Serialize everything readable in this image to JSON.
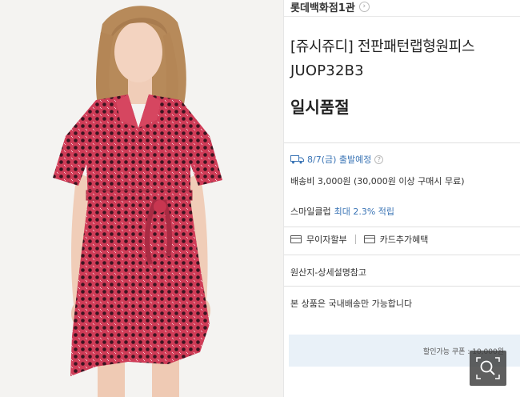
{
  "photo": {
    "alt_icon": "product-photo"
  },
  "panel": {
    "store_name": "롯데백화점1관",
    "store_chevron": "›",
    "product_title": "[쥬시쥬디] 전판패턴랩형원피스",
    "product_code": "JUOP32B3",
    "sold_out": "일시품절",
    "shipping_date": "8/7(금) 출발예정",
    "shipping_help": "?",
    "shipping_fee": "배송비 3,000원 (30,000원 이상 구매시 무료)",
    "smile_club": "스마일클럽",
    "smile_rate": "최대 2.3% 적립",
    "installment": "무이자할부",
    "card_benefit": "카드추가혜택",
    "origin": "원산지-상세설명참고",
    "domestic_only": "본 상품은 국내배송만 가능합니다",
    "coupon": "할인가능 쿠폰 : 10,000원"
  },
  "colors": {
    "accent_blue": "#3a74b5",
    "coupon_bg": "#e9f1f8",
    "dress_red": "#c8384f"
  }
}
